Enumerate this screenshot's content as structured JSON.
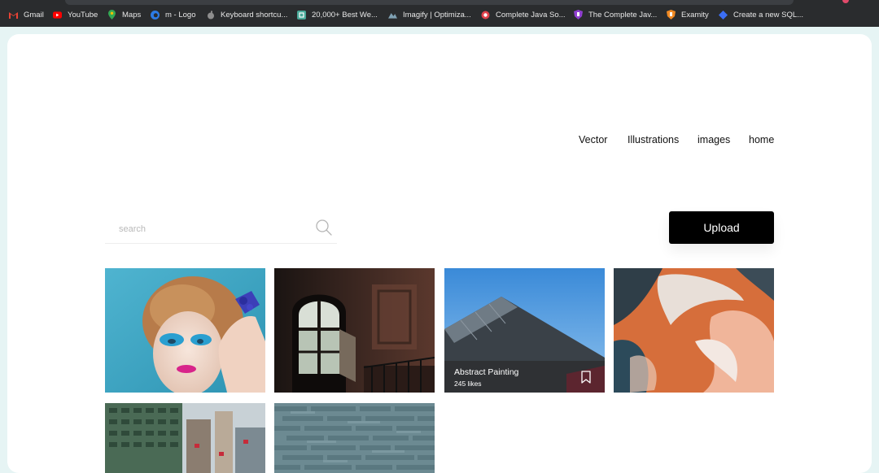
{
  "bookmarks": [
    {
      "label": "Gmail",
      "icon": "gmail-icon"
    },
    {
      "label": "YouTube",
      "icon": "youtube-icon"
    },
    {
      "label": "Maps",
      "icon": "maps-pin-icon"
    },
    {
      "label": "m - Logo",
      "icon": "edge-logo-icon"
    },
    {
      "label": "Keyboard shortcu...",
      "icon": "apple-icon"
    },
    {
      "label": "20,000+ Best We...",
      "icon": "green-square-icon"
    },
    {
      "label": "Imagify | Optimiza...",
      "icon": "imagify-icon"
    },
    {
      "label": "Complete Java So...",
      "icon": "red-circle-icon"
    },
    {
      "label": "The Complete Jav...",
      "icon": "purple-shield-icon"
    },
    {
      "label": "Examity",
      "icon": "orange-shield-icon"
    },
    {
      "label": "Create a new SQL...",
      "icon": "blue-diamond-icon"
    }
  ],
  "nav": {
    "vector": "Vector",
    "illustrations": "Illustrations",
    "images": "images",
    "home": "home"
  },
  "search": {
    "placeholder": "search",
    "value": ""
  },
  "upload": {
    "label": "Upload"
  },
  "gallery": [
    {
      "subject": "woman-blue-makeup"
    },
    {
      "subject": "dark-room-window"
    },
    {
      "subject": "building-roof-sky",
      "title": "Abstract Painting",
      "likes": "245 likes"
    },
    {
      "subject": "abstract-aerial-orange"
    },
    {
      "subject": "city-buildings"
    },
    {
      "subject": "stone-wall-texture"
    }
  ]
}
